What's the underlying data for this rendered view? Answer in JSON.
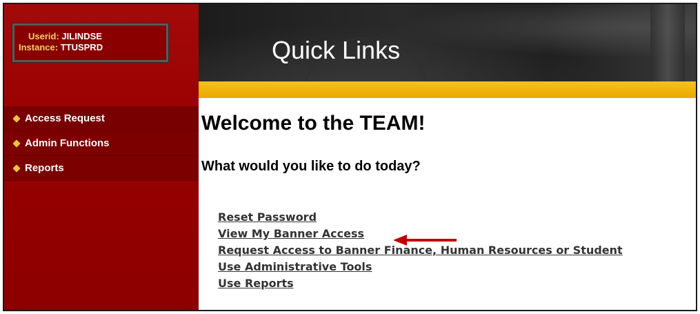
{
  "user_box": {
    "userid_label": "Userid: ",
    "userid_value": "JILINDSE",
    "instance_label": "Instance: ",
    "instance_value": "TTUSPRD"
  },
  "header": {
    "title": "Quick Links"
  },
  "sidebar": {
    "items": [
      {
        "label": "Access Request",
        "icon": "diamond-bullet-icon"
      },
      {
        "label": "Admin Functions",
        "icon": "diamond-bullet-icon"
      },
      {
        "label": "Reports",
        "icon": "diamond-bullet-icon"
      }
    ]
  },
  "main": {
    "welcome": "Welcome to the TEAM!",
    "question": "What would you like to do today?",
    "links": [
      {
        "label": "Reset Password"
      },
      {
        "label": "View My Banner Access"
      },
      {
        "label": "Request Access to Banner Finance, Human Resources or Student"
      },
      {
        "label": "Use Administrative Tools"
      },
      {
        "label": "Use Reports"
      }
    ]
  },
  "colors": {
    "sidebar": "#990000",
    "accent_gold": "#f6c21c",
    "link": "#333333",
    "arrow": "#c00000",
    "user_label": "#f2d36b"
  }
}
